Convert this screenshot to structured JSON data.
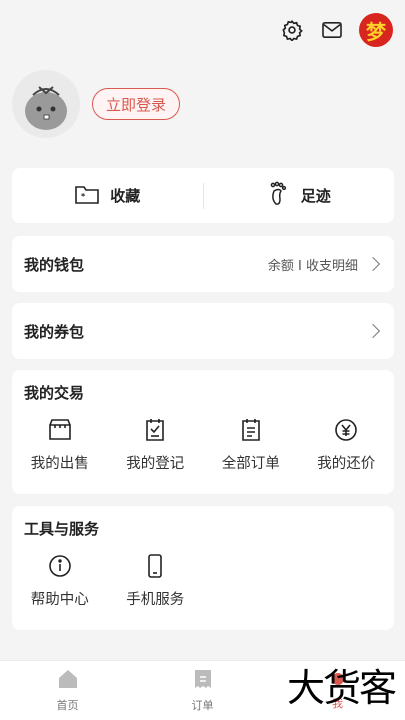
{
  "header": {
    "settings_icon": "gear-icon",
    "message_icon": "mail-icon",
    "brand_avatar_char": "梦"
  },
  "profile": {
    "login_label": "立即登录"
  },
  "favorites": {
    "collect_label": "收藏",
    "footprint_label": "足迹"
  },
  "wallet": {
    "title": "我的钱包",
    "detail": "余额 I 收支明细"
  },
  "coupon": {
    "title": "我的券包"
  },
  "trade": {
    "title": "我的交易",
    "items": [
      {
        "label": "我的出售",
        "icon": "shop-icon"
      },
      {
        "label": "我的登记",
        "icon": "register-icon"
      },
      {
        "label": "全部订单",
        "icon": "orders-icon"
      },
      {
        "label": "我的还价",
        "icon": "yen-icon"
      }
    ]
  },
  "tools": {
    "title": "工具与服务",
    "items": [
      {
        "label": "帮助中心",
        "icon": "info-icon"
      },
      {
        "label": "手机服务",
        "icon": "phone-icon"
      }
    ]
  },
  "tabbar": {
    "tabs": [
      {
        "label": "首页",
        "icon": "home-icon"
      },
      {
        "label": "订单",
        "icon": "order-icon"
      },
      {
        "label": "我",
        "icon": "me-icon"
      }
    ],
    "active": "我",
    "accent": "#d9584f"
  },
  "watermark": "大货客"
}
